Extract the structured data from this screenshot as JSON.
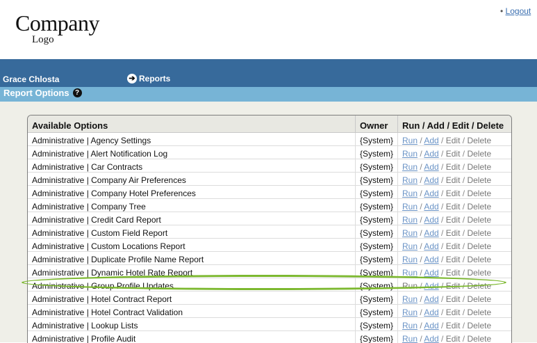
{
  "header": {
    "logo_line1": "Company",
    "logo_line2": "Logo",
    "logout_bullet": "•",
    "logout": "Logout"
  },
  "topbar": {
    "user": "Grace Chlosta",
    "nav_label": "Reports",
    "nav_icon": "right-arrow-icon"
  },
  "section": {
    "title": "Report Options",
    "help_icon": "?"
  },
  "table": {
    "headers": [
      "Available Options",
      "Owner",
      "Run / Add / Edit / Delete"
    ],
    "actions": {
      "run": "Run",
      "add": "Add",
      "edit": "Edit",
      "delete": "Delete",
      "sep": " / "
    },
    "rows": [
      {
        "name": "Administrative | Agency Settings",
        "owner": "{System}",
        "run_enabled": true
      },
      {
        "name": "Administrative | Alert Notification Log",
        "owner": "{System}",
        "run_enabled": true
      },
      {
        "name": "Administrative | Car Contracts",
        "owner": "{System}",
        "run_enabled": true
      },
      {
        "name": "Administrative | Company Air Preferences",
        "owner": "{System}",
        "run_enabled": true
      },
      {
        "name": "Administrative | Company Hotel Preferences",
        "owner": "{System}",
        "run_enabled": true
      },
      {
        "name": "Administrative | Company Tree",
        "owner": "{System}",
        "run_enabled": true
      },
      {
        "name": "Administrative | Credit Card Report",
        "owner": "{System}",
        "run_enabled": true
      },
      {
        "name": "Administrative | Custom Field Report",
        "owner": "{System}",
        "run_enabled": true
      },
      {
        "name": "Administrative | Custom Locations Report",
        "owner": "{System}",
        "run_enabled": true
      },
      {
        "name": "Administrative | Duplicate Profile Name Report",
        "owner": "{System}",
        "run_enabled": true
      },
      {
        "name": "Administrative | Dynamic Hotel Rate Report",
        "owner": "{System}",
        "run_enabled": true
      },
      {
        "name": "Administrative | Group Profile Updates",
        "owner": "{System}",
        "run_enabled": false,
        "highlighted": true
      },
      {
        "name": "Administrative | Hotel Contract Report",
        "owner": "{System}",
        "run_enabled": true
      },
      {
        "name": "Administrative | Hotel Contract Validation",
        "owner": "{System}",
        "run_enabled": true
      },
      {
        "name": "Administrative | Lookup Lists",
        "owner": "{System}",
        "run_enabled": true
      },
      {
        "name": "Administrative | Profile Audit",
        "owner": "{System}",
        "run_enabled": true
      }
    ]
  },
  "colors": {
    "bar_dark": "#376a9b",
    "bar_light": "#77b4d6",
    "highlight": "#7cb82f",
    "link": "#6a93c6"
  }
}
